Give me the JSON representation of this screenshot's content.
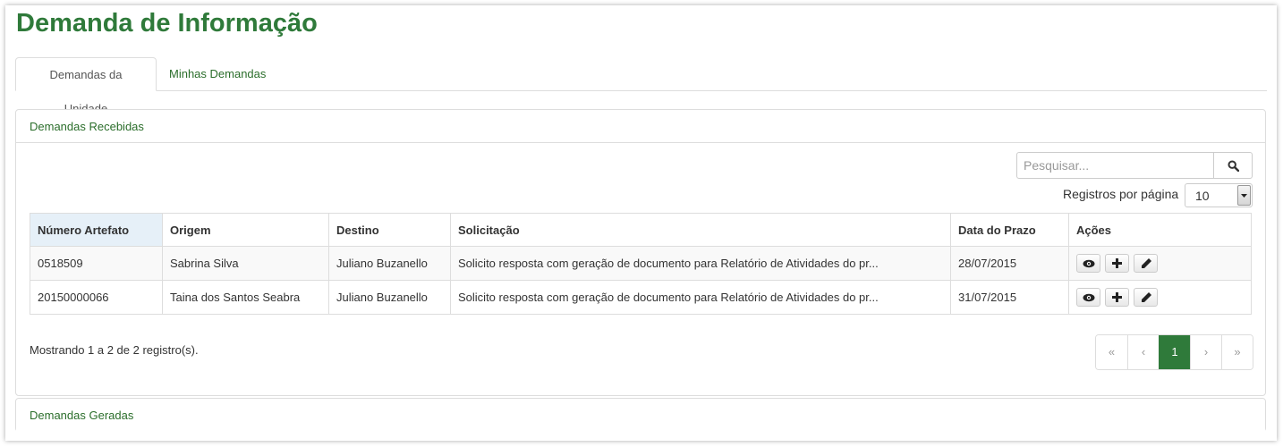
{
  "page": {
    "title": "Demanda de Informação"
  },
  "tabs": [
    {
      "label": "Demandas da Unidade",
      "active": true
    },
    {
      "label": "Minhas Demandas",
      "active": false
    }
  ],
  "received": {
    "heading": "Demandas Recebidas",
    "search": {
      "placeholder": "Pesquisar...",
      "value": ""
    },
    "per_page": {
      "label": "Registros por página",
      "value": "10"
    },
    "columns": [
      "Número Artefato",
      "Origem",
      "Destino",
      "Solicitação",
      "Data do Prazo",
      "Ações"
    ],
    "rows": [
      {
        "numero": "0518509",
        "origem": "Sabrina Silva",
        "destino": "Juliano Buzanello",
        "solicitacao": "Solicito resposta com geração de documento para Relatório de Atividades do pr...",
        "prazo": "28/07/2015"
      },
      {
        "numero": "20150000066",
        "origem": "Taina dos Santos Seabra",
        "destino": "Juliano Buzanello",
        "solicitacao": "Solicito resposta com geração de documento para Relatório de Atividades do pr...",
        "prazo": "31/07/2015"
      }
    ],
    "row_actions": [
      "eye-icon",
      "plus-icon",
      "pencil-icon"
    ],
    "showing": "Mostrando 1 a 2 de 2 registro(s).",
    "pagination": {
      "first": "«",
      "prev": "‹",
      "current": "1",
      "next": "›",
      "last": "»"
    }
  },
  "generated": {
    "heading": "Demandas Geradas"
  },
  "colors": {
    "brand_green": "#2f7a3a",
    "link_green": "#2b6e2b",
    "sorted_header": "#e6f0f8"
  }
}
